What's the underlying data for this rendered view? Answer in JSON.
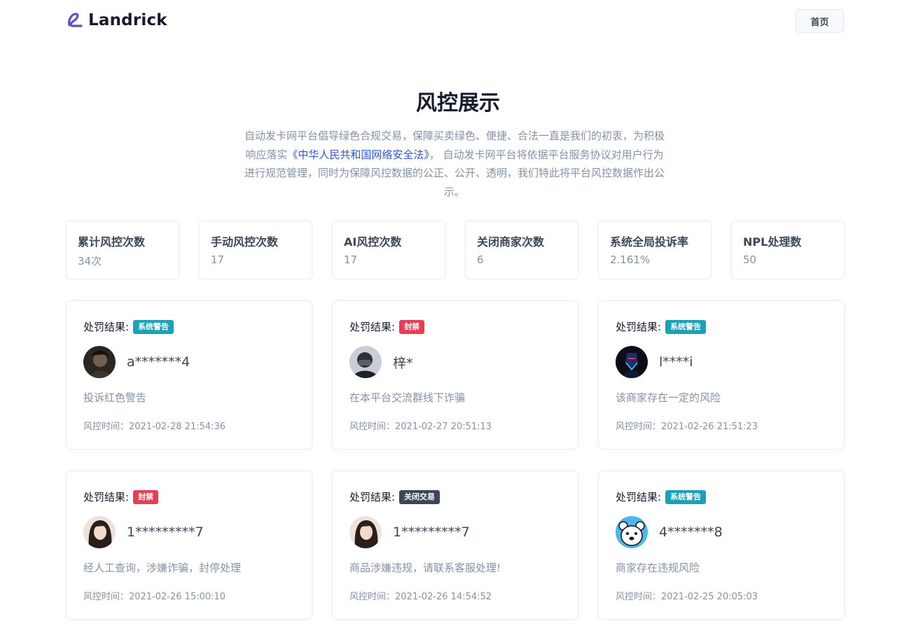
{
  "header": {
    "logo_text": "Landrick",
    "home_label": "首页"
  },
  "hero": {
    "title": "风控展示",
    "desc_part1": "自动发卡网平台倡导绿色合规交易，保障买卖绿色、便捷、合法一直是我们的初衷，为积极响应落实",
    "desc_link": "《中华人民共和国网络安全法》",
    "desc_part2": "， 自动发卡网平台将依据平台服务协议对用户行为进行规范管理，同时为保障风控数据的公正、公开、透明，我们特此将平台风控数据作出公示。"
  },
  "stats": [
    {
      "title": "累计风控次数",
      "value": "34次"
    },
    {
      "title": "手动风控次数",
      "value": "17"
    },
    {
      "title": "AI风控次数",
      "value": "17"
    },
    {
      "title": "关闭商家次数",
      "value": "6"
    },
    {
      "title": "系统全局投诉率",
      "value": "2.161%"
    },
    {
      "title": "NPL处理数",
      "value": "50"
    }
  ],
  "records": [
    {
      "label": "处罚结果:",
      "badge": "系统警告",
      "badge_color": "#1ba3b5",
      "user": "a*******4",
      "avatar": "dark-portrait-avatar",
      "desc": "投诉红色警告",
      "time": "风控时间：2021-02-28 21:54:36"
    },
    {
      "label": "处罚结果:",
      "badge": "封禁",
      "badge_color": "#e43f52",
      "user": "梓*",
      "avatar": "masked-person-avatar",
      "desc": "在本平台交流群线下诈骗",
      "time": "风控时间：2021-02-27 20:51:13"
    },
    {
      "label": "处罚结果:",
      "badge": "系统警告",
      "badge_color": "#1ba3b5",
      "user": "l****i",
      "avatar": "neon-figure-avatar",
      "desc": "该商家存在一定的风险",
      "time": "风控时间：2021-02-26 21:51:23"
    },
    {
      "label": "处罚结果:",
      "badge": "封禁",
      "badge_color": "#e43f52",
      "user": "1*********7",
      "avatar": "woman-portrait-avatar",
      "desc": "经人工查询，涉嫌诈骗，封停处理",
      "time": "风控时间：2021-02-26 15:00:10"
    },
    {
      "label": "处罚结果:",
      "badge": "关闭交易",
      "badge_color": "#3c4858",
      "user": "1*********7",
      "avatar": "woman-portrait-avatar",
      "desc": "商品涉嫌违规，请联系客服处理!",
      "time": "风控时间：2021-02-26 14:54:52"
    },
    {
      "label": "处罚结果:",
      "badge": "系统警告",
      "badge_color": "#1ba3b5",
      "user": "4*******8",
      "avatar": "polar-bear-avatar",
      "desc": "商家存在违规风险",
      "time": "风控时间：2021-02-25 20:05:03"
    }
  ]
}
